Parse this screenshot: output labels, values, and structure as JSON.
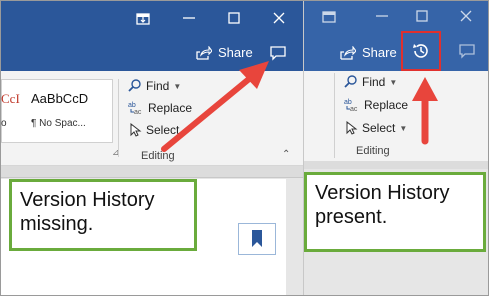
{
  "left": {
    "window_controls": {
      "restore": "⧉",
      "maximize": "☐",
      "close": "✕"
    },
    "share_label": "Share",
    "styles": {
      "style1": "CcI",
      "style2": "AaBbCcD",
      "style1_sub": "o",
      "style2_sub": "¶ No Spac..."
    },
    "editing": {
      "find": "Find",
      "replace": "Replace",
      "select": "Select",
      "group_label": "Editing"
    },
    "callout_text": "Version History missing."
  },
  "right": {
    "window_controls": {
      "restore": "⧉",
      "maximize": "☐",
      "close": "✕"
    },
    "share_label": "Share",
    "editing": {
      "find": "Find",
      "replace": "Replace",
      "select": "Select",
      "group_label": "Editing"
    },
    "callout_text": "Version History present."
  },
  "colors": {
    "title_bar": "#2b579a",
    "ribbon": "#f3f3f3",
    "arrow": "#e8453c",
    "callout_border": "#6aab3c",
    "highlight": "#e0302e"
  },
  "icons": [
    "restore-icon",
    "maximize-icon",
    "close-icon",
    "share-icon",
    "comments-icon",
    "version-history-icon",
    "find-icon",
    "replace-icon",
    "select-icon",
    "bookmark-icon"
  ]
}
